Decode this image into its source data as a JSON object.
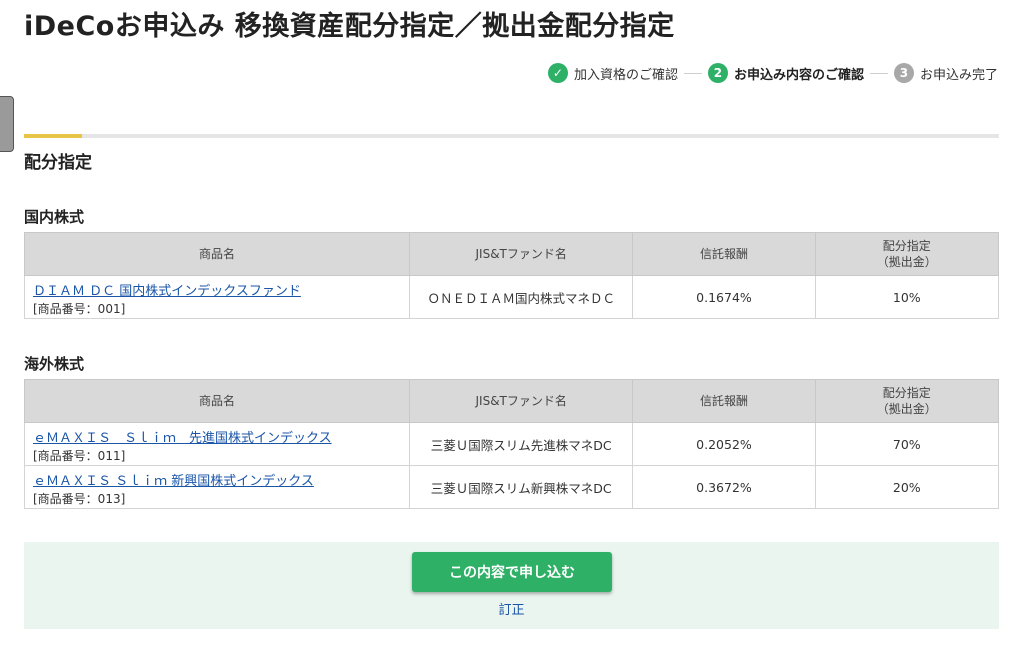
{
  "page": {
    "title": "iDeCoお申込み 移換資産配分指定／拠出金配分指定"
  },
  "steps": [
    {
      "label": "加入資格のご確認",
      "marker": "✓",
      "status": "done"
    },
    {
      "label": "お申込み内容のご確認",
      "marker": "2",
      "status": "current"
    },
    {
      "label": "お申込み完了",
      "marker": "3",
      "status": "todo"
    }
  ],
  "section_title": "配分指定",
  "columns": {
    "name": "商品名",
    "jis": "JIS&Tファンド名",
    "fee": "信託報酬",
    "alloc_line1": "配分指定",
    "alloc_line2": "（拠出金）"
  },
  "groups": [
    {
      "title": "国内株式",
      "funds": [
        {
          "name": "ＤＩＡＭ ＤＣ 国内株式インデックスファンド",
          "code": "[商品番号：001]",
          "jis_name": "ＯＮＥＤＩＡＭ国内株式マネＤＣ",
          "fee": "0.1674%",
          "allocation": "10%"
        }
      ]
    },
    {
      "title": "海外株式",
      "funds": [
        {
          "name": "ｅＭＡＸＩＳ　Ｓｌｉｍ　先進国株式インデックス",
          "code": "[商品番号：011]",
          "jis_name": "三菱Ｕ国際スリム先進株マネDC",
          "fee": "0.2052%",
          "allocation": "70%"
        },
        {
          "name": "ｅＭＡＸＩＳ Ｓｌｉｍ 新興国株式インデックス",
          "code": "[商品番号：013]",
          "jis_name": "三菱Ｕ国際スリム新興株マネDC",
          "fee": "0.3672%",
          "allocation": "20%"
        }
      ]
    }
  ],
  "actions": {
    "submit_label": "この内容で申し込む",
    "edit_label": "訂正"
  },
  "colors": {
    "accent_green": "#2fb067",
    "link_blue": "#1a55a8",
    "tab_yellow": "#e8c547",
    "action_bg": "#e9f5ee"
  }
}
